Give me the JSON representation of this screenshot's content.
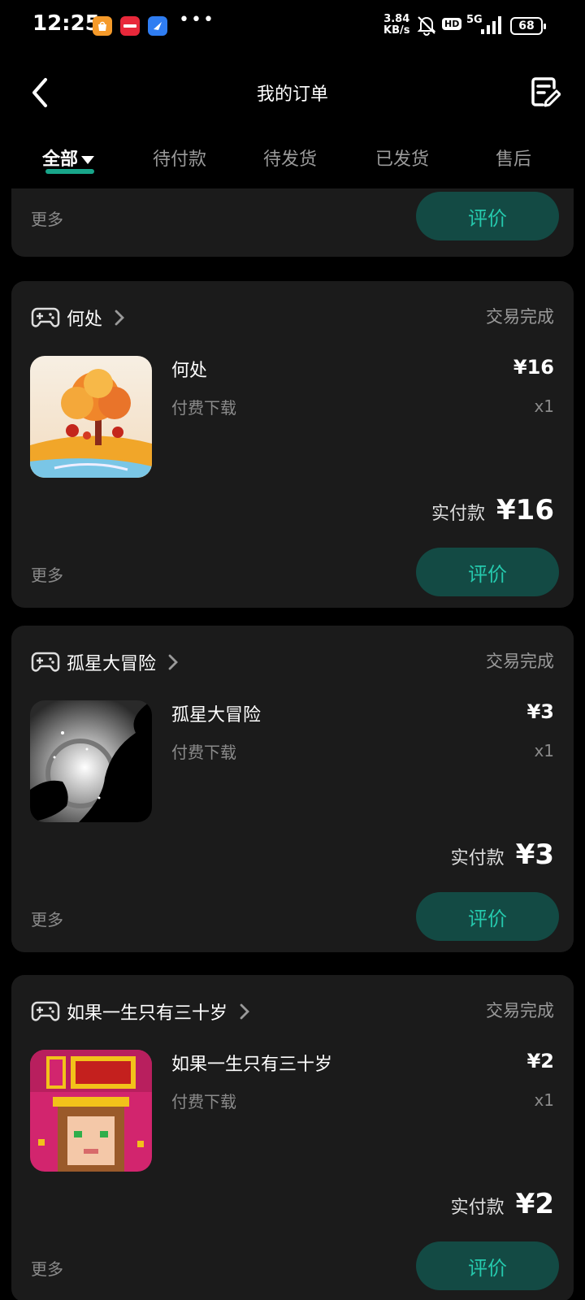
{
  "status_bar": {
    "time": "12:25",
    "apps": [
      "taobao-icon",
      "xiaohongshu-icon",
      "browser-icon"
    ],
    "dots": "•••",
    "speed_value": "3.84",
    "speed_unit": "KB/s",
    "hd": "HD",
    "network": "5G",
    "battery": "68"
  },
  "header": {
    "title": "我的订单"
  },
  "tabs": [
    {
      "label": "全部",
      "active": true
    },
    {
      "label": "待付款"
    },
    {
      "label": "待发货"
    },
    {
      "label": "已发货"
    },
    {
      "label": "售后"
    }
  ],
  "top_card": {
    "more": "更多",
    "review": "评价"
  },
  "orders": [
    {
      "store": "何处",
      "status": "交易完成",
      "product": "何处",
      "type": "付费下载",
      "price": "¥16",
      "qty": "x1",
      "paid_label": "实付款",
      "paid_amount": "¥16",
      "more": "更多",
      "review": "评价"
    },
    {
      "store": "孤星大冒险",
      "status": "交易完成",
      "product": "孤星大冒险",
      "type": "付费下载",
      "price": "¥3",
      "qty": "x1",
      "paid_label": "实付款",
      "paid_amount": "¥3",
      "more": "更多",
      "review": "评价"
    },
    {
      "store": "如果一生只有三十岁",
      "status": "交易完成",
      "product": "如果一生只有三十岁",
      "type": "付费下载",
      "price": "¥2",
      "qty": "x1",
      "paid_label": "实付款",
      "paid_amount": "¥2",
      "more": "更多",
      "review": "评价"
    }
  ],
  "colors": {
    "background": "#000000",
    "card": "#1b1b1b",
    "accent": "#18a58a",
    "button_bg": "#134a44",
    "button_text": "#25c9ad"
  }
}
